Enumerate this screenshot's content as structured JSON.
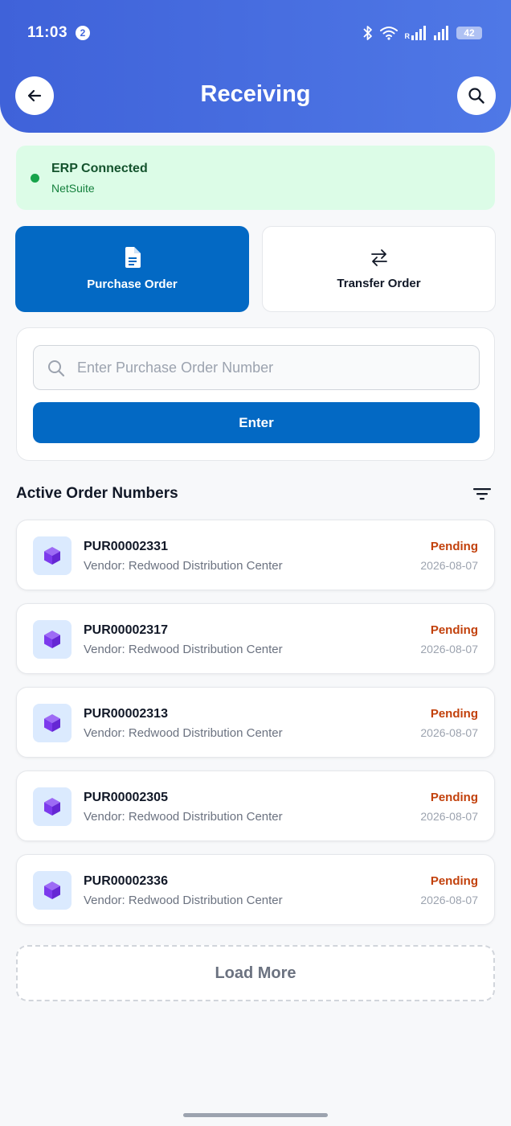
{
  "status_bar": {
    "time": "11:03",
    "notification_count": "2",
    "roaming_label": "R",
    "battery": "42",
    "icons": [
      "bluetooth-icon",
      "wifi-icon",
      "signal-icon",
      "signal-icon",
      "battery-icon"
    ]
  },
  "header": {
    "title": "Receiving",
    "back_icon": "arrow-left-icon",
    "search_icon": "search-icon",
    "gradient": [
      "#3f62d9",
      "#4f78e6"
    ]
  },
  "erp_status": {
    "title": "ERP Connected",
    "system": "NetSuite",
    "dot_color": "#16a34a",
    "background": "#dcfce7"
  },
  "order_types": [
    {
      "label": "Purchase Order",
      "icon": "document-icon",
      "selected": true
    },
    {
      "label": "Transfer Order",
      "icon": "swap-arrows-icon",
      "selected": false
    }
  ],
  "search": {
    "placeholder": "Enter Purchase Order Number",
    "value": "",
    "button_label": "Enter"
  },
  "active_orders": {
    "title": "Active Order Numbers",
    "filter_icon": "filter-icon",
    "items": [
      {
        "number": "PUR00002331",
        "vendor": "Vendor: Redwood Distribution Center",
        "status": "Pending",
        "date": "2026-08-07"
      },
      {
        "number": "PUR00002317",
        "vendor": "Vendor: Redwood Distribution Center",
        "status": "Pending",
        "date": "2026-08-07"
      },
      {
        "number": "PUR00002313",
        "vendor": "Vendor: Redwood Distribution Center",
        "status": "Pending",
        "date": "2026-08-07"
      },
      {
        "number": "PUR00002305",
        "vendor": "Vendor: Redwood Distribution Center",
        "status": "Pending",
        "date": "2026-08-07"
      },
      {
        "number": "PUR00002336",
        "vendor": "Vendor: Redwood Distribution Center",
        "status": "Pending",
        "date": "2026-08-07"
      }
    ],
    "item_icon": "cube-icon"
  },
  "load_more_label": "Load More",
  "colors": {
    "primary": "#0369c4",
    "pending": "#c2410c",
    "cube": "#7c3aed"
  }
}
